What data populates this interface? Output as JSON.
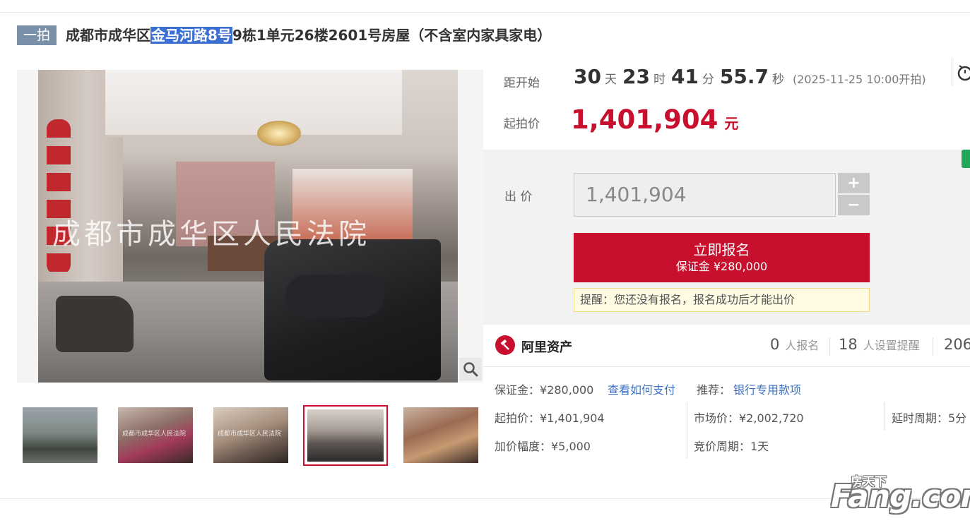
{
  "title": {
    "round_badge": "一拍",
    "prefix": "成都市成华区",
    "highlight": "金马河路8号",
    "suffix": "9栋1单元26楼2601号房屋（不含室内家具家电）"
  },
  "gallery": {
    "watermark": "成都市成华区人民法院",
    "thumb_watermark": "成都市成华区人民法院",
    "thumbnails": [
      {
        "active": false
      },
      {
        "active": false
      },
      {
        "active": false
      },
      {
        "active": true
      },
      {
        "active": false
      }
    ]
  },
  "countdown": {
    "label": "距开始",
    "days": "30",
    "days_unit": "天",
    "hours": "23",
    "hours_unit": "时",
    "minutes": "41",
    "minutes_unit": "分",
    "seconds": "55.7",
    "seconds_unit": "秒",
    "start_note": "(2025-11-25 10:00开拍)"
  },
  "start_price": {
    "label": "起拍价",
    "amount": "1,401,904",
    "currency": "元"
  },
  "bid": {
    "label": "出 价",
    "input_value": "1,401,904",
    "plus": "+",
    "minus": "−"
  },
  "signup_button": {
    "line1": "立即报名",
    "line2": "保证金 ¥280,000"
  },
  "notice": "提醒：您还没有报名，报名成功后才能出价",
  "stats": {
    "brand": "阿里资产",
    "signups_value": "0",
    "signups_label": "人报名",
    "reminders_value": "18",
    "reminders_label": "人设置提醒",
    "views_value": "206"
  },
  "info": {
    "deposit": "保证金：¥280,000",
    "how_to_pay": "查看如何支付",
    "recommend_label": "推荐：",
    "recommend_link": "银行专用款项",
    "start_price": "起拍价：¥1,401,904",
    "market_price": "市场价：¥2,002,720",
    "delay_period": "延时周期：5分",
    "increment": "加价幅度：¥5,000",
    "bid_period": "竞价周期：1天"
  },
  "footer_logo": {
    "cn": "房天下",
    "en": "Fang.com"
  },
  "colors": {
    "accent_red": "#c8102e",
    "badge_gray_blue": "#7a8fa8",
    "link_blue": "#3d73c4",
    "highlight_blue": "#3b6fd4",
    "green_tag": "#21a65a"
  }
}
